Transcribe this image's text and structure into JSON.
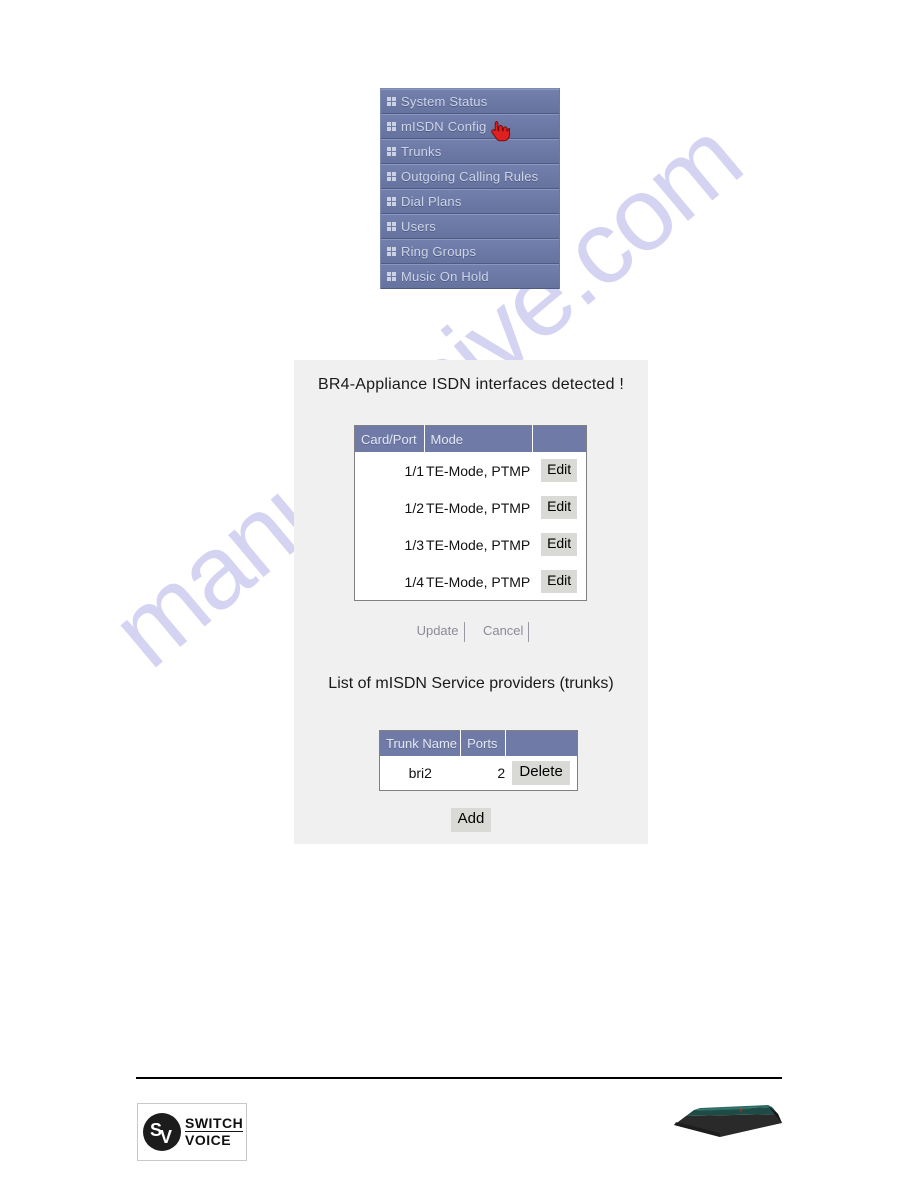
{
  "watermark": {
    "text": "manualshive.com"
  },
  "menu": {
    "icon": "grid-icon",
    "items": [
      {
        "label": "System Status"
      },
      {
        "label": "mISDN Config"
      },
      {
        "label": "Trunks"
      },
      {
        "label": "Outgoing Calling Rules"
      },
      {
        "label": "Dial Plans"
      },
      {
        "label": "Users"
      },
      {
        "label": "Ring Groups"
      },
      {
        "label": "Music On Hold"
      }
    ],
    "cursor_icon": "pointing-hand-cursor",
    "cursor_on_item": "mISDN Config",
    "colors": {
      "background": "#6f7ba6",
      "text": "#cdd4e8",
      "separator": "#4e5a85"
    }
  },
  "panel": {
    "title": "BR4-Appliance ISDN interfaces detected !",
    "isdn_table": {
      "headers": [
        "Card/Port",
        "Mode",
        ""
      ],
      "rows": [
        {
          "card_port": "1/1",
          "mode": "TE-Mode, PTMP",
          "action": "Edit"
        },
        {
          "card_port": "1/2",
          "mode": "TE-Mode, PTMP",
          "action": "Edit"
        },
        {
          "card_port": "1/3",
          "mode": "TE-Mode, PTMP",
          "action": "Edit"
        },
        {
          "card_port": "1/4",
          "mode": "TE-Mode, PTMP",
          "action": "Edit"
        }
      ]
    },
    "update_button": "Update",
    "cancel_button": "Cancel",
    "trunks_title": "List of mISDN Service providers (trunks)",
    "trunk_table": {
      "headers": [
        "Trunk Name",
        "Ports",
        ""
      ],
      "rows": [
        {
          "trunk_name": "bri2",
          "ports": "2",
          "action": "Delete"
        }
      ]
    },
    "add_button": "Add",
    "colors": {
      "panel_background": "#f0f0f0",
      "table_header": "#6f7ba6",
      "button_face": "#d9d9d5",
      "table_border": "#808080"
    }
  },
  "footer": {
    "logo": {
      "monogram_s": "S",
      "monogram_v": "V",
      "word_top": "SWITCH",
      "word_bottom": "VOICE"
    },
    "device_image": "isdn-appliance-photo"
  }
}
